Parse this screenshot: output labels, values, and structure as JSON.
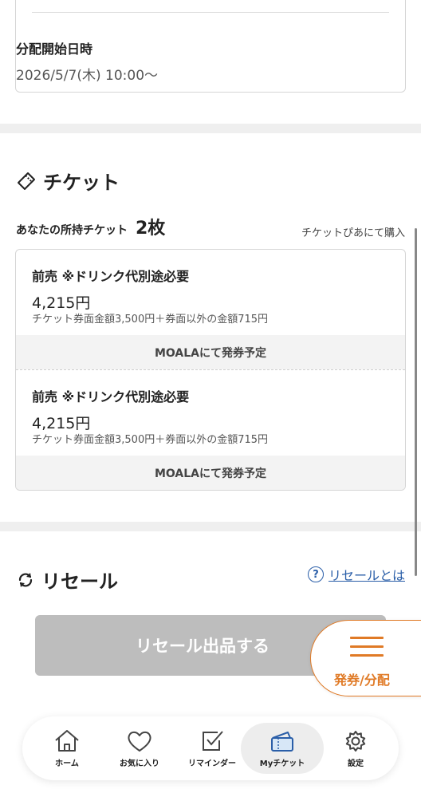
{
  "distribution": {
    "label": "分配開始日時",
    "value": "2026/5/7(木) 10:00〜"
  },
  "ticket_section": {
    "title": "チケット",
    "owned_label": "あなたの所持チケット",
    "owned_count": "2枚",
    "buy_link": "チケットぴあにて購入",
    "tickets": [
      {
        "name": "前売 ※ドリンク代別途必要",
        "price": "4,215円",
        "detail": "チケット券面金額3,500円＋券面以外の金額715円",
        "status": "MOALAにて発券予定"
      },
      {
        "name": "前売 ※ドリンク代別途必要",
        "price": "4,215円",
        "detail": "チケット券面金額3,500円＋券面以外の金額715円",
        "status": "MOALAにて発券予定"
      }
    ]
  },
  "resale": {
    "title": "リセール",
    "help_link": "リセールとは",
    "help_icon": "?",
    "button": "リセール出品する"
  },
  "fab": {
    "label": "発券/分配"
  },
  "nav": {
    "items": [
      {
        "label": "ホーム",
        "icon": "home-icon"
      },
      {
        "label": "お気に入り",
        "icon": "heart-icon"
      },
      {
        "label": "リマインダー",
        "icon": "checkbox-icon"
      },
      {
        "label": "Myチケット",
        "icon": "ticket-icon",
        "active": true
      },
      {
        "label": "設定",
        "icon": "gear-icon"
      }
    ]
  },
  "colors": {
    "accent": "#e07a26",
    "link": "#2a5ea8",
    "disabled_button": "#bdbdbd"
  }
}
